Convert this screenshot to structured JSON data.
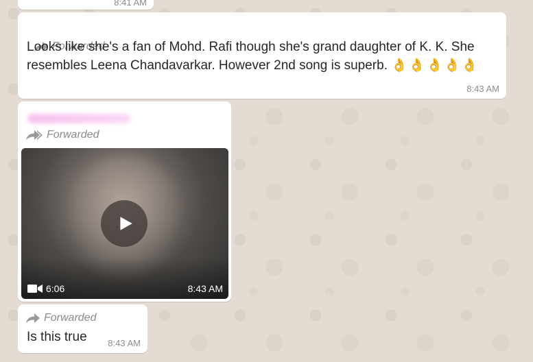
{
  "previous_message": {
    "time": "8:41 AM"
  },
  "messages": [
    {
      "forwarded_label": "Forwarded",
      "text": "Looks like she's a fan of Mohd. Rafi though she's grand daughter of K. K. She resembles Leena Chandavarkar. However 2nd song is superb.",
      "emoji": "👌👌👌👌👌",
      "time": "8:43 AM"
    },
    {
      "forwarded_label": "Forwarded",
      "video": {
        "duration": "6:06",
        "time": "8:43 AM",
        "icon": "play-icon"
      }
    },
    {
      "forwarded_label": "Forwarded",
      "text": "Is this true",
      "time": "8:43 AM"
    }
  ],
  "icons": {
    "forwarded": "forward-arrow-icon",
    "video": "video-camera-icon",
    "play": "play-icon"
  },
  "colors": {
    "wallpaper": "#e4dcd3",
    "bubble": "#ffffff",
    "meta_text": "#8c8c8c"
  }
}
